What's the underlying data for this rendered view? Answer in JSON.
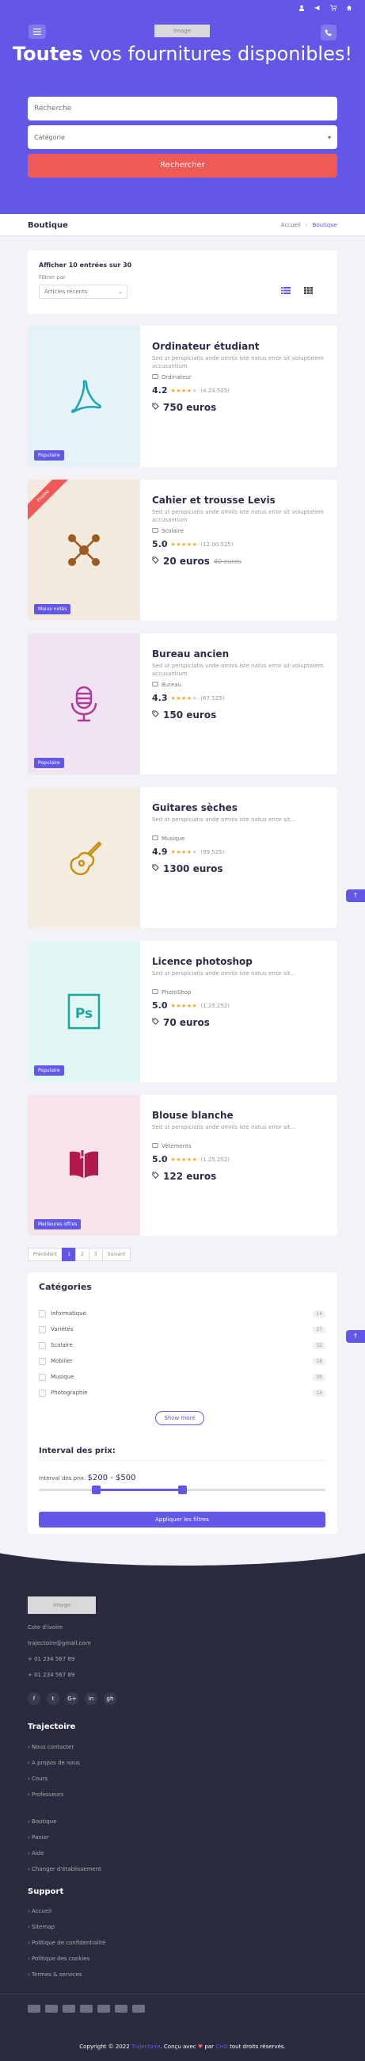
{
  "topbar": {
    "icons": [
      "user-icon",
      "megaphone-icon",
      "cart-icon",
      "home-icon"
    ],
    "logo_text": "Image"
  },
  "hero": {
    "title_bold": "Toutes",
    "title_rest": "vos fournitures disponibles!",
    "search_placeholder": "Recherche",
    "category_placeholder": "Catégorie",
    "search_button": "Rechercher"
  },
  "breadcrumb_bar": {
    "title": "Boutique",
    "crumbs": [
      "Accueil",
      "Boutique"
    ]
  },
  "listing": {
    "show_text": "Afficher 10 entrées sur 30",
    "sort_label": "Filtrer par",
    "sort_value": "Articles récents"
  },
  "products": [
    {
      "name": "Ordinateur étudiant",
      "description": "Sed ut perspiciatis unde omnis iste natus error sit voluptatem accusantium",
      "category": "Ordinateur",
      "rating": "4.2",
      "stars": 4,
      "count": "(4.24.525)",
      "price": "750 euros",
      "old_price": "",
      "ribbon": "",
      "badge": "Populaire",
      "icon": "acrobat-icon",
      "bg": "#e3f3f7",
      "accent": "#1fa5b0"
    },
    {
      "name": "Cahier et trousse Levis",
      "description": "Sed ut perspiciatis unde omnis iste natus error sit voluptatem accusantium",
      "category": "Scolaire",
      "rating": "5.0",
      "stars": 5,
      "count": "(12.00.525)",
      "price": "20 euros",
      "old_price": "40 euros",
      "ribbon": "Promo",
      "badge": "Mieux notés",
      "icon": "network-icon",
      "bg": "#f2e9df",
      "accent": "#9b5a1e"
    },
    {
      "name": "Bureau ancien",
      "description": "Sed ut perspiciatis unde omnis iste natus error sit voluptatem accusantium",
      "category": "Bureau",
      "rating": "4.3",
      "stars": 4,
      "count": "(67.525)",
      "price": "150 euros",
      "old_price": "",
      "ribbon": "",
      "badge": "Populaire",
      "icon": "microphone-icon",
      "bg": "#f2e3f2",
      "accent": "#b03a9a"
    },
    {
      "name": "Guitares sèches",
      "description": "Sed ut perspiciatis unde omnis iste natus error sit...",
      "category": "Musique",
      "rating": "4.9",
      "stars": 4,
      "count": "(99.525)",
      "price": "1300 euros",
      "old_price": "",
      "ribbon": "",
      "badge": "",
      "icon": "guitar-icon",
      "bg": "#f3ece0",
      "accent": "#c9900e"
    },
    {
      "name": "Licence photoshop",
      "description": "Sed ut perspiciatis unde omnis iste natus error sit...",
      "category": "PhotoShop",
      "rating": "5.0",
      "stars": 5,
      "count": "(1.25.252)",
      "price": "70 euros",
      "old_price": "",
      "ribbon": "",
      "badge": "Populaire",
      "icon": "photoshop-icon",
      "bg": "#e2f6f6",
      "accent": "#1aa7a0"
    },
    {
      "name": "Blouse blanche",
      "description": "Sed ut perspiciatis unde omnis iste natus error sit...",
      "category": "Vêtements",
      "rating": "5.0",
      "stars": 5,
      "count": "(1.25.252)",
      "price": "122 euros",
      "old_price": "",
      "ribbon": "",
      "badge": "Meilleures offres",
      "icon": "book-icon",
      "bg": "#f7e3ea",
      "accent": "#b01a4e"
    }
  ],
  "pagination": [
    "Précédent",
    "1",
    "2",
    "3",
    "Suivant"
  ],
  "categories": {
    "title": "Catégories",
    "items": [
      {
        "label": "Informatique",
        "count": "14"
      },
      {
        "label": "Variétés",
        "count": "27"
      },
      {
        "label": "Scolaire",
        "count": "32"
      },
      {
        "label": "Mobilier",
        "count": "18"
      },
      {
        "label": "Musique",
        "count": "39"
      },
      {
        "label": "Photographie",
        "count": "14"
      }
    ],
    "show_more": "Show more"
  },
  "price_filter": {
    "title": "Interval des prix:",
    "label": "Interval des prix:",
    "range": "$200 - $500",
    "low_fraction": 0.2,
    "high_fraction": 0.5,
    "apply": "Appliquer les filtres"
  },
  "footer": {
    "logo_text": "Image",
    "contact": [
      "Cote d'ivoire",
      "trajectoire@gmail.com",
      "+ 01 234 567 89",
      "+ 01 234 567 89"
    ],
    "socials": [
      "f",
      "t",
      "G+",
      "in",
      "gh"
    ],
    "brand_heading": "Trajectoire",
    "links1": [
      "Nous contacter",
      "A propos de nous",
      "Cours",
      "Professeurs"
    ],
    "links2": [
      "Boutique",
      "Panier",
      "Aide",
      "Changer d'établissement"
    ],
    "support_heading": "Support",
    "support_links": [
      "Accueil",
      "Sitemap",
      "Politique de confidentialité",
      "Politique des cookies",
      "Termes & services"
    ],
    "copyright_prefix": "Copyright © 2022",
    "copyright_brand": "Trajectoire",
    "copyright_mid": ". Conçu avec",
    "copyright_by": "par",
    "copyright_author": "CHO",
    "copyright_suffix": "tout droits réservés."
  }
}
